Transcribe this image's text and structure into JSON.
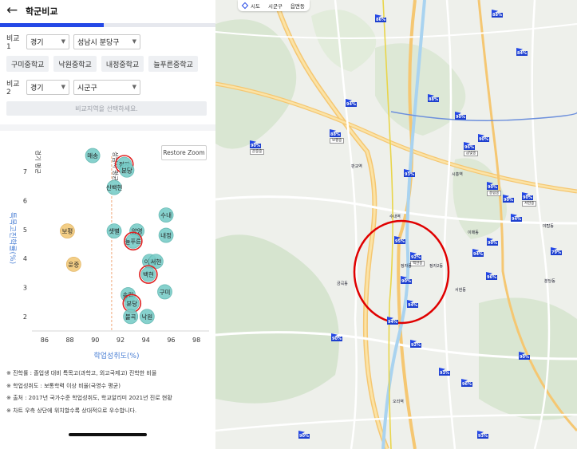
{
  "header": {
    "back_icon": "arrow-left-icon",
    "title": "학군비교",
    "progress_percent": 48
  },
  "compare1": {
    "label": "비교1",
    "province": "경기",
    "district": "성남시 분당구",
    "schools": [
      "구미중학교",
      "낙원중학교",
      "내정중학교",
      "늘푸른중학교"
    ]
  },
  "compare2": {
    "label": "비교2",
    "province": "경기",
    "district": "시군구",
    "action_label": "비교지역을 선택하세요."
  },
  "restore_zoom_label": "Restore Zoom",
  "chart_data": {
    "type": "scatter",
    "xlabel": "학업성취도(%)",
    "ylabel": "특목고진학률(%)",
    "xlim": [
      85,
      99
    ],
    "ylim": [
      1.5,
      7.8
    ],
    "xticks": [
      86,
      88,
      90,
      92,
      94,
      96,
      98
    ],
    "yticks": [
      2,
      3,
      4,
      5,
      6,
      7
    ],
    "avg_x": 91.3,
    "avg_x_label": "성남시 평균",
    "avg_y_label": "경기 평균",
    "colors": {
      "school": "#79cdc8",
      "school_stroke": "#5ab4ae",
      "other": "#f2c97a",
      "other_stroke": "#e1b15c",
      "highlight": "#e02020",
      "avg_line": "#f0a878"
    },
    "points": [
      {
        "name": "매송",
        "x": 89.8,
        "y": 7.55,
        "kind": "school"
      },
      {
        "name": "정자",
        "x": 92.3,
        "y": 7.25,
        "kind": "school",
        "highlight": true
      },
      {
        "name": "분당",
        "x": 92.5,
        "y": 7.05,
        "kind": "school"
      },
      {
        "name": "신백현",
        "x": 91.5,
        "y": 6.45,
        "kind": "school"
      },
      {
        "name": "수내",
        "x": 95.6,
        "y": 5.5,
        "kind": "school"
      },
      {
        "name": "보평",
        "x": 87.8,
        "y": 4.95,
        "kind": "other"
      },
      {
        "name": "샛별",
        "x": 91.5,
        "y": 4.95,
        "kind": "school"
      },
      {
        "name": "양영",
        "x": 93.3,
        "y": 4.95,
        "kind": "school"
      },
      {
        "name": "내정",
        "x": 95.6,
        "y": 4.8,
        "kind": "school"
      },
      {
        "name": "늘푸른",
        "x": 93.0,
        "y": 4.6,
        "kind": "school",
        "highlight": true
      },
      {
        "name": "이매",
        "x": 94.3,
        "y": 3.9,
        "kind": "school"
      },
      {
        "name": "서현",
        "x": 94.8,
        "y": 3.9,
        "kind": "school"
      },
      {
        "name": "운중",
        "x": 88.3,
        "y": 3.8,
        "kind": "other"
      },
      {
        "name": "백현",
        "x": 94.2,
        "y": 3.45,
        "kind": "school",
        "highlight": true
      },
      {
        "name": "구미",
        "x": 95.5,
        "y": 2.85,
        "kind": "school"
      },
      {
        "name": "송림",
        "x": 92.6,
        "y": 2.75,
        "kind": "school"
      },
      {
        "name": "분당",
        "x": 92.9,
        "y": 2.45,
        "kind": "school",
        "highlight": true
      },
      {
        "name": "불곡",
        "x": 92.8,
        "y": 2.0,
        "kind": "school"
      },
      {
        "name": "낙원",
        "x": 94.1,
        "y": 2.0,
        "kind": "school"
      }
    ]
  },
  "notes": [
    "※ 진학률 : 졸업생 대비 특목고(과학고, 외고국제고) 진학한 비율",
    "※ 학업성취도 : 보통학력 이상 비율(국영수 평균)",
    "※ 출처 : 2017년 국가수준 학업성취도, 학교알리미 2021년 진로 현황",
    "※ 차트 우측 상단에 위치할수록 상대적으로 우수합니다."
  ],
  "map": {
    "tabs": [
      {
        "label": "시도",
        "icon": "diamond-icon"
      },
      {
        "label": "시군구"
      },
      {
        "label": "읍면동"
      }
    ],
    "pins": [
      {
        "pct": "88%",
        "name": ""
      },
      {
        "pct": "86%",
        "name": ""
      },
      {
        "pct": "84%",
        "name": ""
      },
      {
        "pct": "94%",
        "name": ""
      },
      {
        "pct": "88%",
        "name": ""
      },
      {
        "pct": "90%",
        "name": ""
      },
      {
        "pct": "96%",
        "name": "금빛중"
      },
      {
        "pct": "90%",
        "name": "운중중"
      },
      {
        "pct": "90%",
        "name": ""
      },
      {
        "pct": "88%",
        "name": "보평중"
      },
      {
        "pct": "90%",
        "name": "송림중"
      },
      {
        "pct": "93%",
        "name": ""
      },
      {
        "pct": "94%",
        "name": ""
      },
      {
        "pct": "90%",
        "name": ""
      },
      {
        "pct": "90%",
        "name": "서현중"
      },
      {
        "pct": "94%",
        "name": ""
      },
      {
        "pct": "90%",
        "name": ""
      },
      {
        "pct": "95%",
        "name": ""
      },
      {
        "pct": "92%",
        "name": "백현중"
      },
      {
        "pct": "90%",
        "name": ""
      },
      {
        "pct": "96%",
        "name": ""
      },
      {
        "pct": "94%",
        "name": ""
      },
      {
        "pct": "79%",
        "name": ""
      },
      {
        "pct": "94%",
        "name": ""
      },
      {
        "pct": "92%",
        "name": ""
      },
      {
        "pct": "90%",
        "name": ""
      },
      {
        "pct": "93%",
        "name": ""
      },
      {
        "pct": "96%",
        "name": ""
      },
      {
        "pct": "90%",
        "name": ""
      },
      {
        "pct": "93%",
        "name": ""
      },
      {
        "pct": "90%",
        "name": ""
      }
    ],
    "labels": [
      "시흥역",
      "정자동",
      "정자2동",
      "금곡동",
      "분당동",
      "야탑동",
      "이매동",
      "서현동",
      "판교역",
      "수내역",
      "오리역"
    ],
    "highlight_circle_color": "#e00000"
  }
}
